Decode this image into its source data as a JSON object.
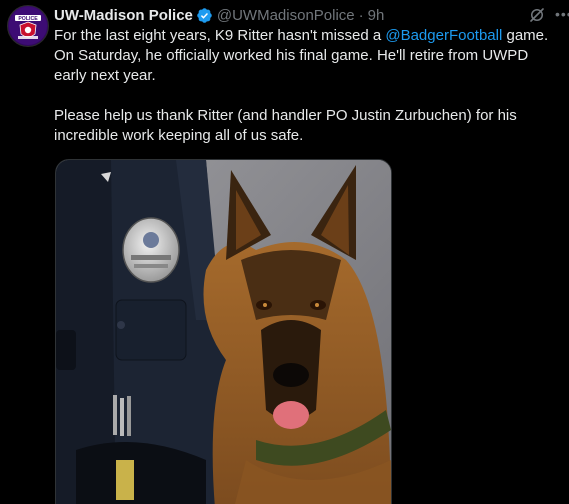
{
  "tweet": {
    "author": {
      "display_name": "UW-Madison Police",
      "handle": "@UWMadisonPolice",
      "verified": true,
      "avatar_icon": "police-badge-avatar"
    },
    "separator": "·",
    "time": "9h",
    "text": {
      "line1_pre": "For the last eight years, K9 Ritter hasn't missed a ",
      "mention": "@BadgerFootball",
      "line1_post": " game.",
      "line2": "On Saturday, he officially worked his final game. He'll retire from UWPD early next year.",
      "line3": "Please help us thank Ritter (and handler PO Justin Zurbuchen) for his incredible work keeping all of us safe."
    },
    "media": {
      "icon": "photo-k9-ritter-with-officer"
    },
    "actions": {
      "grok_icon": "grok-icon",
      "more_icon": "more-options-icon"
    }
  },
  "colors": {
    "background": "#000000",
    "text": "#e7e9ea",
    "muted": "#71767b",
    "link": "#1d9bf0",
    "verified": "#1d9bf0"
  }
}
